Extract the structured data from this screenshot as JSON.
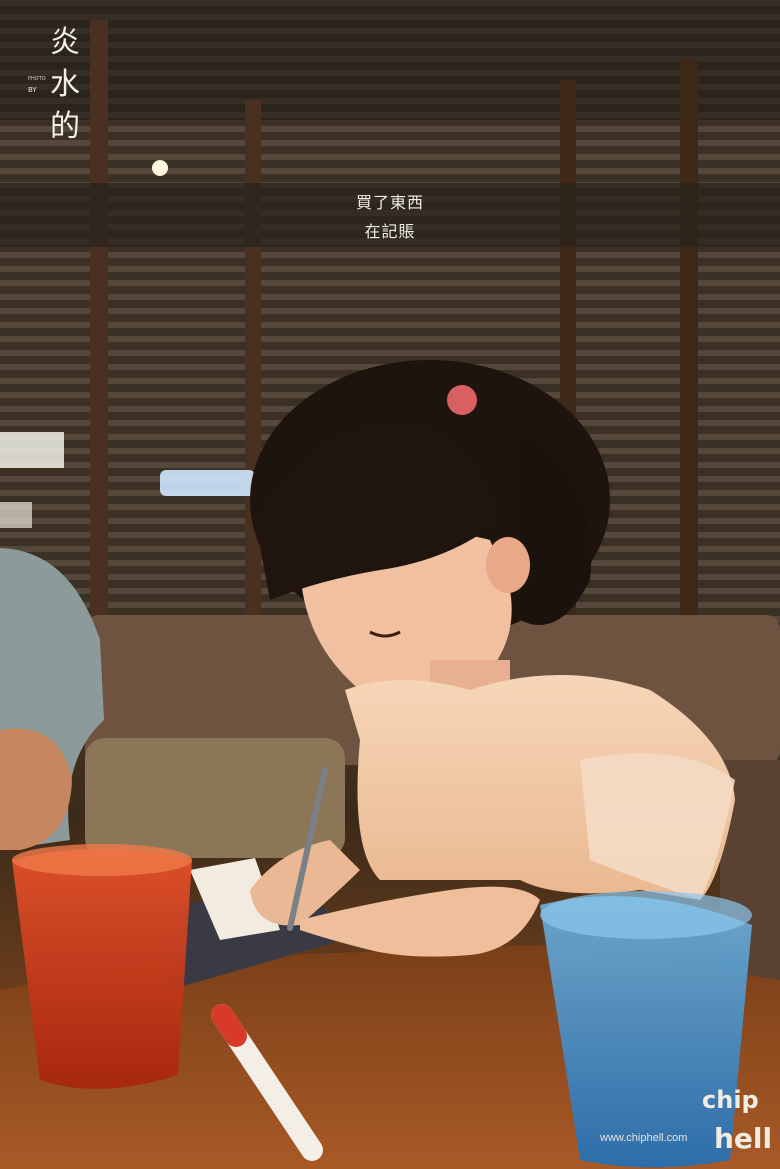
{
  "caption": {
    "line1": "買了東西",
    "line2": "在記賬"
  },
  "signature": {
    "text": "炎水的",
    "by": "PHOTO BY"
  },
  "watermark": {
    "url": "www.chiphell.com",
    "logo": "chiphell"
  },
  "colors": {
    "caption_band": "#28221c",
    "dress": "#f2c9a8",
    "red_cup": "#d8401e",
    "blue_cup": "#3a8fc8",
    "table": "#8a4a1e"
  }
}
